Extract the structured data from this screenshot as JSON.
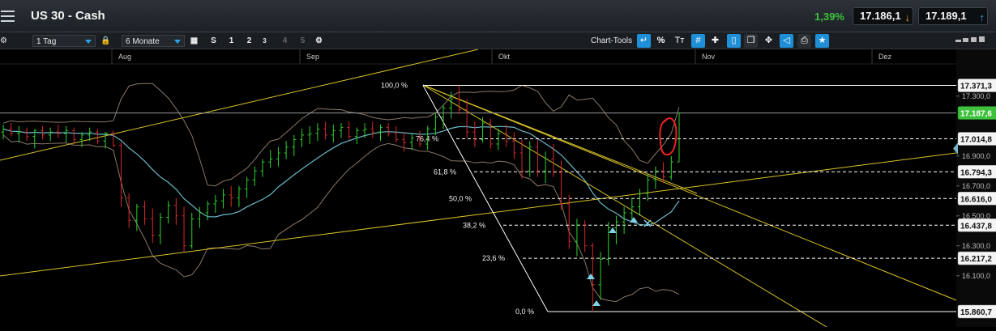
{
  "header": {
    "title": "US 30 - Cash",
    "change": "1,39%",
    "sell_price": "17.186,1",
    "buy_price": "17.189,1"
  },
  "toolbar": {
    "interval": "1 Tag",
    "range": "6 Monate",
    "zoom_buttons": [
      "S",
      "1",
      "2",
      "3",
      "4",
      "5"
    ],
    "chart_tools_label": "Chart-Tools",
    "percent_label": "%",
    "text_tool_label": "Tᴛ"
  },
  "colors": {
    "up": "#2fd12f",
    "down": "#d62a2a",
    "trendline": "#d8c227",
    "fib": "#ffffff",
    "ma": "#6ab8c8",
    "bands": "#8a7868",
    "accent": "#1f8fd8",
    "price_tag": "#3ec23e"
  },
  "chart_data": {
    "type": "candlestick",
    "x_labels": [
      "Aug",
      "Sep",
      "Okt",
      "Nov",
      "Dez"
    ],
    "y_ticks": [
      "17.300,0",
      "16.900,0",
      "16.700,0",
      "16.500,0",
      "16.300,0",
      "16.100,0"
    ],
    "ylim": [
      15850,
      17450
    ],
    "price_tags": [
      {
        "label": "17.371,3",
        "value": 17371.3,
        "style": "white"
      },
      {
        "label": "17.187,6",
        "value": 17187.6,
        "style": "green"
      },
      {
        "label": "17.014,8",
        "value": 17014.8,
        "style": "white"
      },
      {
        "label": "16.794,3",
        "value": 16794.3,
        "style": "white"
      },
      {
        "label": "16.616,0",
        "value": 16616.0,
        "style": "white"
      },
      {
        "label": "16.437,8",
        "value": 16437.8,
        "style": "white"
      },
      {
        "label": "16.217,2",
        "value": 16217.2,
        "style": "white"
      },
      {
        "label": "15.860,7",
        "value": 15860.7,
        "style": "white"
      }
    ],
    "fibonacci": {
      "high": 17371.3,
      "low": 15860.7,
      "levels": [
        {
          "label": "100,0 %",
          "value": 17371.3
        },
        {
          "label": "76,4 %",
          "value": 17014.8
        },
        {
          "label": "61,8 %",
          "value": 16794.3
        },
        {
          "label": "50,0 %",
          "value": 16616.0
        },
        {
          "label": "38,2 %",
          "value": 16437.8
        },
        {
          "label": "23,6 %",
          "value": 16217.2
        },
        {
          "label": "0,0 %",
          "value": 15860.7
        }
      ]
    },
    "candles": [
      {
        "o": 17060,
        "h": 17110,
        "l": 17010,
        "c": 17080
      },
      {
        "o": 17080,
        "h": 17120,
        "l": 17030,
        "c": 17050
      },
      {
        "o": 17050,
        "h": 17100,
        "l": 16990,
        "c": 17060
      },
      {
        "o": 17060,
        "h": 17090,
        "l": 17000,
        "c": 17030
      },
      {
        "o": 17030,
        "h": 17080,
        "l": 16950,
        "c": 17070
      },
      {
        "o": 17070,
        "h": 17100,
        "l": 17010,
        "c": 17040
      },
      {
        "o": 17040,
        "h": 17090,
        "l": 17000,
        "c": 17060
      },
      {
        "o": 17060,
        "h": 17110,
        "l": 17020,
        "c": 17050
      },
      {
        "o": 17050,
        "h": 17100,
        "l": 16990,
        "c": 17070
      },
      {
        "o": 17070,
        "h": 17090,
        "l": 16980,
        "c": 17010
      },
      {
        "o": 17010,
        "h": 17060,
        "l": 16960,
        "c": 17040
      },
      {
        "o": 17040,
        "h": 17090,
        "l": 17000,
        "c": 17060
      },
      {
        "o": 17060,
        "h": 17080,
        "l": 16980,
        "c": 17000
      },
      {
        "o": 17000,
        "h": 17060,
        "l": 16950,
        "c": 17050
      },
      {
        "o": 17050,
        "h": 17070,
        "l": 16960,
        "c": 16970
      },
      {
        "o": 16970,
        "h": 16990,
        "l": 16560,
        "c": 16620
      },
      {
        "o": 16620,
        "h": 16650,
        "l": 16420,
        "c": 16470
      },
      {
        "o": 16470,
        "h": 16580,
        "l": 16400,
        "c": 16560
      },
      {
        "o": 16560,
        "h": 16600,
        "l": 16440,
        "c": 16480
      },
      {
        "o": 16480,
        "h": 16550,
        "l": 16320,
        "c": 16370
      },
      {
        "o": 16370,
        "h": 16520,
        "l": 16310,
        "c": 16490
      },
      {
        "o": 16490,
        "h": 16600,
        "l": 16450,
        "c": 16570
      },
      {
        "o": 16570,
        "h": 16620,
        "l": 16440,
        "c": 16500
      },
      {
        "o": 16500,
        "h": 16560,
        "l": 16260,
        "c": 16300
      },
      {
        "o": 16300,
        "h": 16520,
        "l": 16280,
        "c": 16480
      },
      {
        "o": 16480,
        "h": 16560,
        "l": 16420,
        "c": 16520
      },
      {
        "o": 16520,
        "h": 16600,
        "l": 16470,
        "c": 16580
      },
      {
        "o": 16580,
        "h": 16640,
        "l": 16520,
        "c": 16600
      },
      {
        "o": 16600,
        "h": 16680,
        "l": 16550,
        "c": 16640
      },
      {
        "o": 16640,
        "h": 16700,
        "l": 16560,
        "c": 16620
      },
      {
        "o": 16620,
        "h": 16700,
        "l": 16560,
        "c": 16680
      },
      {
        "o": 16680,
        "h": 16760,
        "l": 16620,
        "c": 16740
      },
      {
        "o": 16740,
        "h": 16830,
        "l": 16700,
        "c": 16800
      },
      {
        "o": 16800,
        "h": 16880,
        "l": 16760,
        "c": 16860
      },
      {
        "o": 16860,
        "h": 16940,
        "l": 16820,
        "c": 16880
      },
      {
        "o": 16880,
        "h": 16960,
        "l": 16830,
        "c": 16920
      },
      {
        "o": 16920,
        "h": 17000,
        "l": 16880,
        "c": 16960
      },
      {
        "o": 16960,
        "h": 17040,
        "l": 16900,
        "c": 17010
      },
      {
        "o": 17010,
        "h": 17080,
        "l": 16960,
        "c": 17040
      },
      {
        "o": 17040,
        "h": 17100,
        "l": 16980,
        "c": 17050
      },
      {
        "o": 17050,
        "h": 17120,
        "l": 17000,
        "c": 17080
      },
      {
        "o": 17080,
        "h": 17130,
        "l": 17010,
        "c": 17040
      },
      {
        "o": 17040,
        "h": 17110,
        "l": 16990,
        "c": 17070
      },
      {
        "o": 17070,
        "h": 17120,
        "l": 17020,
        "c": 17090
      },
      {
        "o": 17090,
        "h": 17130,
        "l": 17010,
        "c": 17030
      },
      {
        "o": 17030,
        "h": 17090,
        "l": 16980,
        "c": 17070
      },
      {
        "o": 17070,
        "h": 17120,
        "l": 17020,
        "c": 17080
      },
      {
        "o": 17080,
        "h": 17130,
        "l": 17020,
        "c": 17060
      },
      {
        "o": 17060,
        "h": 17110,
        "l": 17000,
        "c": 17090
      },
      {
        "o": 17090,
        "h": 17120,
        "l": 17030,
        "c": 17050
      },
      {
        "o": 17050,
        "h": 17100,
        "l": 16990,
        "c": 17010
      },
      {
        "o": 17010,
        "h": 17060,
        "l": 16930,
        "c": 16990
      },
      {
        "o": 16990,
        "h": 17050,
        "l": 16940,
        "c": 17020
      },
      {
        "o": 17020,
        "h": 17070,
        "l": 16960,
        "c": 16980
      },
      {
        "o": 16980,
        "h": 17100,
        "l": 16940,
        "c": 17080
      },
      {
        "o": 17080,
        "h": 17190,
        "l": 17040,
        "c": 17160
      },
      {
        "o": 17160,
        "h": 17240,
        "l": 17080,
        "c": 17220
      },
      {
        "o": 17220,
        "h": 17330,
        "l": 17150,
        "c": 17280
      },
      {
        "o": 17280,
        "h": 17371,
        "l": 17180,
        "c": 17210
      },
      {
        "o": 17210,
        "h": 17280,
        "l": 17020,
        "c": 17060
      },
      {
        "o": 17060,
        "h": 17130,
        "l": 16960,
        "c": 17010
      },
      {
        "o": 17010,
        "h": 17160,
        "l": 16990,
        "c": 17120
      },
      {
        "o": 17120,
        "h": 17150,
        "l": 16950,
        "c": 16980
      },
      {
        "o": 16980,
        "h": 17080,
        "l": 16940,
        "c": 17050
      },
      {
        "o": 17050,
        "h": 17110,
        "l": 16960,
        "c": 17000
      },
      {
        "o": 17000,
        "h": 17060,
        "l": 16880,
        "c": 16920
      },
      {
        "o": 16920,
        "h": 17010,
        "l": 16750,
        "c": 16800
      },
      {
        "o": 16800,
        "h": 17000,
        "l": 16760,
        "c": 16960
      },
      {
        "o": 16960,
        "h": 17010,
        "l": 16760,
        "c": 16800
      },
      {
        "o": 16800,
        "h": 16930,
        "l": 16720,
        "c": 16880
      },
      {
        "o": 16880,
        "h": 16980,
        "l": 16760,
        "c": 16790
      },
      {
        "o": 16790,
        "h": 16870,
        "l": 16540,
        "c": 16580
      },
      {
        "o": 16580,
        "h": 16640,
        "l": 16280,
        "c": 16330
      },
      {
        "o": 16330,
        "h": 16480,
        "l": 16230,
        "c": 16440
      },
      {
        "o": 16440,
        "h": 16470,
        "l": 16260,
        "c": 16300
      },
      {
        "o": 16300,
        "h": 16320,
        "l": 15860,
        "c": 16040
      },
      {
        "o": 16040,
        "h": 16260,
        "l": 15940,
        "c": 16210
      },
      {
        "o": 16210,
        "h": 16460,
        "l": 16170,
        "c": 16420
      },
      {
        "o": 16420,
        "h": 16500,
        "l": 16310,
        "c": 16460
      },
      {
        "o": 16460,
        "h": 16560,
        "l": 16380,
        "c": 16520
      },
      {
        "o": 16520,
        "h": 16620,
        "l": 16460,
        "c": 16560
      },
      {
        "o": 16560,
        "h": 16680,
        "l": 16500,
        "c": 16650
      },
      {
        "o": 16650,
        "h": 16780,
        "l": 16600,
        "c": 16740
      },
      {
        "o": 16740,
        "h": 16830,
        "l": 16680,
        "c": 16800
      },
      {
        "o": 16800,
        "h": 16860,
        "l": 16720,
        "c": 16760
      },
      {
        "o": 16760,
        "h": 16900,
        "l": 16740,
        "c": 16860
      },
      {
        "o": 16860,
        "h": 17188,
        "l": 16860,
        "c": 17187
      }
    ],
    "series": [
      {
        "name": "",
        "role": "moving-average"
      },
      {
        "name": "",
        "role": "bollinger-upper"
      },
      {
        "name": "",
        "role": "bollinger-lower"
      }
    ]
  }
}
